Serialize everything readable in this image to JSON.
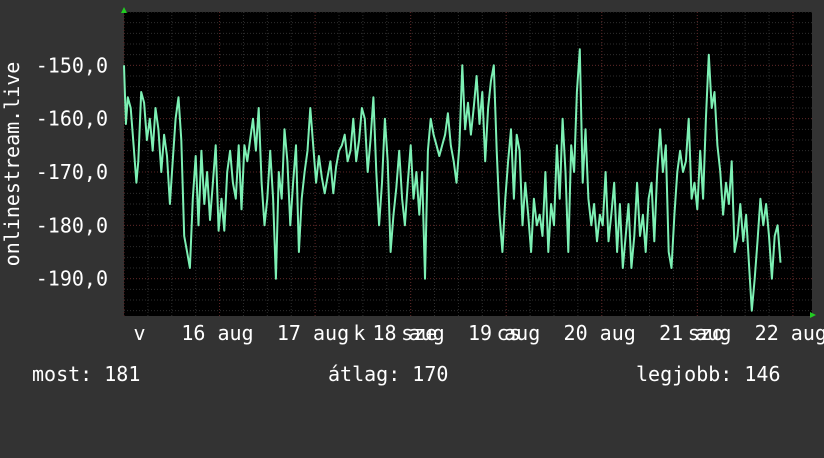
{
  "stats": {
    "now": "most: 181",
    "avg": "átlag: 170",
    "best": "legjobb: 146"
  },
  "colors": {
    "background": "#333333",
    "plot_background": "#000000",
    "line": "#7df0b4",
    "major_grid": "#5a2323",
    "minor_grid": "#2e2e2e",
    "axis_arrow": "#22cc22",
    "text": "#ffffff"
  },
  "chart_data": {
    "type": "line",
    "title": "",
    "ylabel": "onlinestream.live",
    "xlabel": "",
    "y_axis_inverted": true,
    "ylim": [
      -197,
      -140
    ],
    "yticks": [
      -150,
      -160,
      -170,
      -180,
      -190
    ],
    "ytick_labels": [
      "-150,0",
      "-160,0",
      "-170,0",
      "-180,0",
      "-190,0"
    ],
    "xlim": [
      15.7,
      22.9
    ],
    "xticks": [
      15.8,
      16.3,
      17.3,
      18.3,
      19.3,
      20.3,
      21.3,
      22.3
    ],
    "xtick_labels": [
      "v",
      "16 aug",
      "17 aug",
      "18 aug",
      "19 aug",
      "20 aug",
      "21 aug",
      "22 aug"
    ],
    "x_overlay_labels": [
      {
        "x": 18.1,
        "label": "k"
      },
      {
        "x": 18.6,
        "label": "sze"
      },
      {
        "x": 19.6,
        "label": "cs"
      },
      {
        "x": 21.6,
        "label": "szo"
      }
    ],
    "x_vertical_gridlines": [
      15.7,
      16.7,
      17.7,
      18.7,
      19.7,
      20.7,
      21.7,
      22.7
    ],
    "grid": true,
    "series": [
      {
        "values": [
          [
            15.7,
            -150
          ],
          [
            15.72,
            -161
          ],
          [
            15.74,
            -156
          ],
          [
            15.77,
            -158
          ],
          [
            15.8,
            -165
          ],
          [
            15.83,
            -172
          ],
          [
            15.85,
            -168
          ],
          [
            15.88,
            -155
          ],
          [
            15.91,
            -157
          ],
          [
            15.94,
            -164
          ],
          [
            15.97,
            -160
          ],
          [
            16.0,
            -166
          ],
          [
            16.03,
            -158
          ],
          [
            16.06,
            -162
          ],
          [
            16.09,
            -170
          ],
          [
            16.12,
            -163
          ],
          [
            16.15,
            -167
          ],
          [
            16.18,
            -176
          ],
          [
            16.21,
            -168
          ],
          [
            16.24,
            -160
          ],
          [
            16.27,
            -156
          ],
          [
            16.3,
            -164
          ],
          [
            16.33,
            -182
          ],
          [
            16.36,
            -185
          ],
          [
            16.39,
            -188
          ],
          [
            16.42,
            -175
          ],
          [
            16.45,
            -167
          ],
          [
            16.48,
            -180
          ],
          [
            16.51,
            -166
          ],
          [
            16.54,
            -176
          ],
          [
            16.57,
            -170
          ],
          [
            16.6,
            -179
          ],
          [
            16.63,
            -172
          ],
          [
            16.66,
            -165
          ],
          [
            16.69,
            -181
          ],
          [
            16.72,
            -175
          ],
          [
            16.75,
            -181
          ],
          [
            16.78,
            -170
          ],
          [
            16.81,
            -166
          ],
          [
            16.84,
            -172
          ],
          [
            16.87,
            -175
          ],
          [
            16.9,
            -165
          ],
          [
            16.93,
            -177
          ],
          [
            16.96,
            -165
          ],
          [
            16.99,
            -168
          ],
          [
            17.02,
            -164
          ],
          [
            17.05,
            -160
          ],
          [
            17.08,
            -166
          ],
          [
            17.11,
            -158
          ],
          [
            17.14,
            -172
          ],
          [
            17.17,
            -180
          ],
          [
            17.2,
            -175
          ],
          [
            17.23,
            -166
          ],
          [
            17.26,
            -175
          ],
          [
            17.29,
            -190
          ],
          [
            17.32,
            -170
          ],
          [
            17.35,
            -175
          ],
          [
            17.38,
            -162
          ],
          [
            17.41,
            -168
          ],
          [
            17.44,
            -180
          ],
          [
            17.47,
            -172
          ],
          [
            17.5,
            -165
          ],
          [
            17.53,
            -185
          ],
          [
            17.56,
            -175
          ],
          [
            17.59,
            -170
          ],
          [
            17.62,
            -166
          ],
          [
            17.65,
            -158
          ],
          [
            17.68,
            -165
          ],
          [
            17.71,
            -172
          ],
          [
            17.74,
            -167
          ],
          [
            17.77,
            -171
          ],
          [
            17.8,
            -174
          ],
          [
            17.83,
            -171
          ],
          [
            17.86,
            -168
          ],
          [
            17.89,
            -174
          ],
          [
            17.92,
            -169
          ],
          [
            17.95,
            -166
          ],
          [
            17.98,
            -165
          ],
          [
            18.01,
            -163
          ],
          [
            18.04,
            -168
          ],
          [
            18.07,
            -166
          ],
          [
            18.1,
            -160
          ],
          [
            18.13,
            -168
          ],
          [
            18.16,
            -164
          ],
          [
            18.19,
            -158
          ],
          [
            18.22,
            -160
          ],
          [
            18.25,
            -170
          ],
          [
            18.28,
            -164
          ],
          [
            18.31,
            -156
          ],
          [
            18.34,
            -170
          ],
          [
            18.37,
            -180
          ],
          [
            18.4,
            -172
          ],
          [
            18.43,
            -160
          ],
          [
            18.46,
            -168
          ],
          [
            18.49,
            -185
          ],
          [
            18.52,
            -178
          ],
          [
            18.55,
            -173
          ],
          [
            18.58,
            -166
          ],
          [
            18.61,
            -175
          ],
          [
            18.64,
            -180
          ],
          [
            18.67,
            -172
          ],
          [
            18.7,
            -165
          ],
          [
            18.73,
            -175
          ],
          [
            18.76,
            -170
          ],
          [
            18.79,
            -178
          ],
          [
            18.82,
            -170
          ],
          [
            18.85,
            -190
          ],
          [
            18.88,
            -166
          ],
          [
            18.91,
            -160
          ],
          [
            18.94,
            -163
          ],
          [
            18.97,
            -165
          ],
          [
            19.0,
            -167
          ],
          [
            19.03,
            -165
          ],
          [
            19.06,
            -163
          ],
          [
            19.09,
            -159
          ],
          [
            19.12,
            -165
          ],
          [
            19.15,
            -168
          ],
          [
            19.18,
            -172
          ],
          [
            19.21,
            -165
          ],
          [
            19.24,
            -150
          ],
          [
            19.27,
            -162
          ],
          [
            19.3,
            -157
          ],
          [
            19.33,
            -163
          ],
          [
            19.36,
            -158
          ],
          [
            19.39,
            -152
          ],
          [
            19.42,
            -161
          ],
          [
            19.45,
            -155
          ],
          [
            19.48,
            -168
          ],
          [
            19.51,
            -158
          ],
          [
            19.54,
            -153
          ],
          [
            19.57,
            -150
          ],
          [
            19.6,
            -166
          ],
          [
            19.63,
            -178
          ],
          [
            19.66,
            -185
          ],
          [
            19.69,
            -175
          ],
          [
            19.72,
            -168
          ],
          [
            19.75,
            -162
          ],
          [
            19.78,
            -175
          ],
          [
            19.81,
            -163
          ],
          [
            19.84,
            -166
          ],
          [
            19.87,
            -180
          ],
          [
            19.9,
            -172
          ],
          [
            19.93,
            -178
          ],
          [
            19.96,
            -185
          ],
          [
            19.99,
            -175
          ],
          [
            20.02,
            -180
          ],
          [
            20.05,
            -178
          ],
          [
            20.08,
            -182
          ],
          [
            20.11,
            -170
          ],
          [
            20.14,
            -185
          ],
          [
            20.17,
            -176
          ],
          [
            20.2,
            -180
          ],
          [
            20.23,
            -165
          ],
          [
            20.26,
            -175
          ],
          [
            20.29,
            -160
          ],
          [
            20.32,
            -170
          ],
          [
            20.35,
            -185
          ],
          [
            20.38,
            -165
          ],
          [
            20.41,
            -170
          ],
          [
            20.44,
            -155
          ],
          [
            20.47,
            -147
          ],
          [
            20.5,
            -172
          ],
          [
            20.53,
            -162
          ],
          [
            20.56,
            -175
          ],
          [
            20.59,
            -180
          ],
          [
            20.62,
            -176
          ],
          [
            20.65,
            -183
          ],
          [
            20.68,
            -178
          ],
          [
            20.71,
            -180
          ],
          [
            20.74,
            -170
          ],
          [
            20.77,
            -183
          ],
          [
            20.8,
            -178
          ],
          [
            20.83,
            -172
          ],
          [
            20.86,
            -185
          ],
          [
            20.89,
            -176
          ],
          [
            20.92,
            -188
          ],
          [
            20.95,
            -182
          ],
          [
            20.98,
            -176
          ],
          [
            21.01,
            -188
          ],
          [
            21.04,
            -182
          ],
          [
            21.07,
            -172
          ],
          [
            21.1,
            -182
          ],
          [
            21.13,
            -178
          ],
          [
            21.16,
            -185
          ],
          [
            21.19,
            -175
          ],
          [
            21.22,
            -172
          ],
          [
            21.25,
            -183
          ],
          [
            21.28,
            -170
          ],
          [
            21.31,
            -162
          ],
          [
            21.34,
            -170
          ],
          [
            21.37,
            -165
          ],
          [
            21.4,
            -185
          ],
          [
            21.43,
            -188
          ],
          [
            21.46,
            -178
          ],
          [
            21.49,
            -170
          ],
          [
            21.52,
            -166
          ],
          [
            21.55,
            -170
          ],
          [
            21.58,
            -168
          ],
          [
            21.61,
            -160
          ],
          [
            21.64,
            -175
          ],
          [
            21.67,
            -172
          ],
          [
            21.7,
            -177
          ],
          [
            21.73,
            -166
          ],
          [
            21.76,
            -175
          ],
          [
            21.79,
            -160
          ],
          [
            21.82,
            -148
          ],
          [
            21.85,
            -158
          ],
          [
            21.88,
            -155
          ],
          [
            21.91,
            -165
          ],
          [
            21.94,
            -170
          ],
          [
            21.97,
            -178
          ],
          [
            22.0,
            -172
          ],
          [
            22.03,
            -176
          ],
          [
            22.06,
            -168
          ],
          [
            22.09,
            -185
          ],
          [
            22.12,
            -182
          ],
          [
            22.15,
            -176
          ],
          [
            22.18,
            -183
          ],
          [
            22.21,
            -178
          ],
          [
            22.24,
            -187
          ],
          [
            22.27,
            -196
          ],
          [
            22.3,
            -190
          ],
          [
            22.33,
            -183
          ],
          [
            22.36,
            -175
          ],
          [
            22.39,
            -180
          ],
          [
            22.42,
            -176
          ],
          [
            22.45,
            -182
          ],
          [
            22.48,
            -190
          ],
          [
            22.51,
            -182
          ],
          [
            22.54,
            -180
          ],
          [
            22.57,
            -187
          ]
        ]
      }
    ]
  }
}
